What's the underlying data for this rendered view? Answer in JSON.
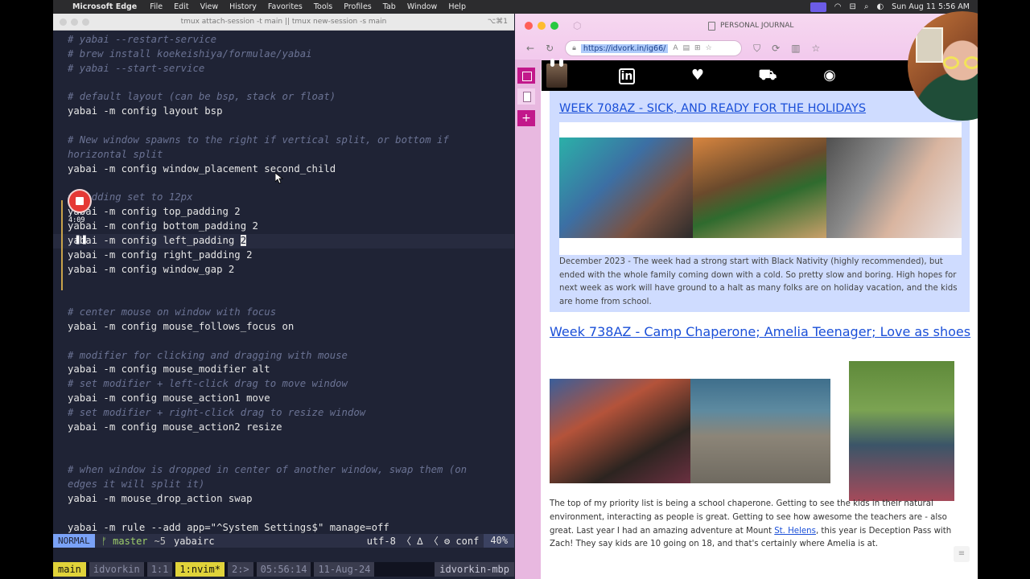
{
  "menubar": {
    "apple": "",
    "app_name": "Microsoft Edge",
    "items": [
      "File",
      "Edit",
      "View",
      "History",
      "Favorites",
      "Tools",
      "Profiles",
      "Tab",
      "Window",
      "Help"
    ],
    "datetime": "Sun Aug 11  5:56 AM"
  },
  "terminal": {
    "title": "tmux attach-session -t main || tmux new-session -s main",
    "shortcut": "⌥⌘1",
    "lines": [
      {
        "text": "# yabai --restart-service",
        "type": "comment"
      },
      {
        "text": "# brew install koekeishiya/formulae/yabai",
        "type": "comment"
      },
      {
        "text": "# yabai --start-service",
        "type": "comment"
      },
      {
        "text": "",
        "type": "code"
      },
      {
        "text": "# default layout (can be bsp, stack or float)",
        "type": "comment"
      },
      {
        "text": "yabai -m config layout bsp",
        "type": "code"
      },
      {
        "text": "",
        "type": "code"
      },
      {
        "text": "# New window spawns to the right if vertical split, or bottom if",
        "type": "comment"
      },
      {
        "text": "horizontal split",
        "type": "comment"
      },
      {
        "text": "yabai -m config window_placement second_child",
        "type": "code"
      },
      {
        "text": "",
        "type": "code"
      },
      {
        "text": "# padding set to 12px",
        "type": "comment"
      },
      {
        "text": "yabai -m config top_padding 2",
        "type": "code"
      },
      {
        "text": "yabai -m config bottom_padding 2",
        "type": "code"
      },
      {
        "text": "yabai -m config left_padding 2",
        "type": "cursor"
      },
      {
        "text": "yabai -m config right_padding 2",
        "type": "code"
      },
      {
        "text": "yabai -m config window_gap 2",
        "type": "code"
      },
      {
        "text": "",
        "type": "code"
      },
      {
        "text": "",
        "type": "code"
      },
      {
        "text": "# center mouse on window with focus",
        "type": "comment"
      },
      {
        "text": "yabai -m config mouse_follows_focus on",
        "type": "code"
      },
      {
        "text": "",
        "type": "code"
      },
      {
        "text": "# modifier for clicking and dragging with mouse",
        "type": "comment"
      },
      {
        "text": "yabai -m config mouse_modifier alt",
        "type": "code"
      },
      {
        "text": "# set modifier + left-click drag to move window",
        "type": "comment"
      },
      {
        "text": "yabai -m config mouse_action1 move",
        "type": "code"
      },
      {
        "text": "# set modifier + right-click drag to resize window",
        "type": "comment"
      },
      {
        "text": "yabai -m config mouse_action2 resize",
        "type": "code"
      },
      {
        "text": "",
        "type": "code"
      },
      {
        "text": "",
        "type": "code"
      },
      {
        "text": "# when window is dropped in center of another window, swap them (on",
        "type": "comment"
      },
      {
        "text": "edges it will split it)",
        "type": "comment"
      },
      {
        "text": "yabai -m mouse_drop_action swap",
        "type": "code"
      },
      {
        "text": "",
        "type": "code"
      },
      {
        "text": "yabai -m rule --add app=\"^System Settings$\" manage=off",
        "type": "code"
      }
    ],
    "recording": {
      "time": "4:09",
      "pause_glyph": "❚❚"
    },
    "statusline": {
      "mode": "NORMAL",
      "branch": "ᚠ master",
      "diff": "~5",
      "file": "yabairc",
      "encoding": "utf-8 〈 ∆ 〈 ⚙ conf",
      "percent": "40%"
    },
    "tmux": {
      "session": "main",
      "user": "idvorkin",
      "pane": "1:1",
      "window_active": "1:nvim*",
      "window_next": "2:>",
      "time": "05:56:14",
      "date": "11-Aug-24",
      "host": "idvorkin-mbp"
    }
  },
  "browser": {
    "tab_title": "PERSONAL JOURNAL",
    "url": "https://idvork.in/ig66/",
    "accent": "#c2188b",
    "nav": {
      "linkedin": "in",
      "heart": "♥",
      "stroller": "⛟",
      "github": "◉"
    },
    "card": {
      "title": "WEEK 708AZ - SICK, AND READY FOR THE HOLIDAYS",
      "text": "December 2023 - The week had a strong start with Black Nativity (highly recommended), but ended with the whole family coming down with a cold. So pretty slow and boring. High hopes for next week as work will have ground to a halt as many folks are on holiday vacation, and the kids are home from school."
    },
    "post": {
      "title": "Week 738AZ - Camp Chaperone; Amelia Teenager; Love as shoes",
      "text_before": "The top of my priority list is being a school chaperone. Getting to see the kids in their natural environment, interacting as people is great. Getting to see how awesome the teachers are - also great. Last year I had an amazing adventure at Mount ",
      "link": "St. Helens",
      "text_after": ", this year is Deception Pass with Zach! They say kids are 10 going on 18, and that's certainly where Amelia is at."
    },
    "scroll_icon": "≡"
  }
}
